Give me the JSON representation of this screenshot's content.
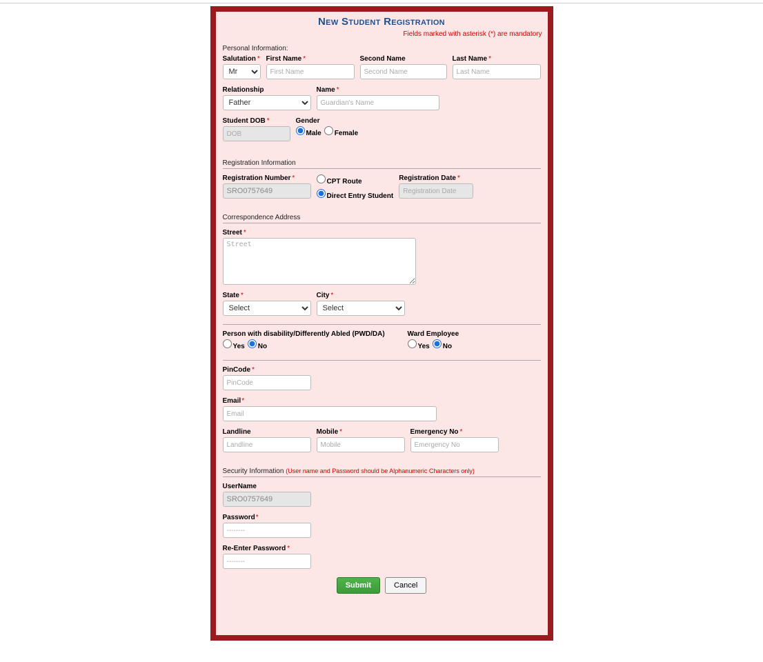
{
  "header": {
    "title": "New Student Registration",
    "mandatory_note": "Fields marked with asterisk (*) are mandatory"
  },
  "sections": {
    "personal": "Personal Information:",
    "registration": "Registration Information",
    "correspondence": "Correspondence Address",
    "security": "Security Information",
    "security_hint": "(User name and Password should be Alphanumeric Characters only)"
  },
  "labels": {
    "salutation": "Salutation",
    "first_name": "First Name",
    "second_name": "Second Name",
    "last_name": "Last Name",
    "relationship": "Relationship",
    "guardian_name": "Name",
    "student_dob": "Student DOB",
    "gender": "Gender",
    "male": "Male",
    "female": "Female",
    "reg_number": "Registration Number",
    "cpt_route": "CPT Route",
    "direct_entry": "Direct Entry Student",
    "reg_date": "Registration Date",
    "street": "Street",
    "state": "State",
    "city": "City",
    "pwd": "Person with disability/Differently Abled (PWD/DA)",
    "ward": "Ward Employee",
    "yes": "Yes",
    "no": "No",
    "pincode": "PinCode",
    "email": "Email",
    "landline": "Landline",
    "mobile": "Mobile",
    "emergency": "Emergency No",
    "username": "UserName",
    "password": "Password",
    "reenter_password": "Re-Enter Password"
  },
  "placeholders": {
    "first_name": "First Name",
    "second_name": "Second Name",
    "last_name": "Last Name",
    "guardian_name": "Guardian's Name",
    "dob": "DOB",
    "reg_date": "Registration Date",
    "street": "Street",
    "pincode": "PinCode",
    "email": "Email",
    "landline": "Landline",
    "mobile": "Mobile",
    "emergency": "Emergency No",
    "password": "--------",
    "reenter_password": "--------"
  },
  "values": {
    "salutation": "Mr",
    "relationship": "Father",
    "reg_number": "SRO0757649",
    "state": "Select",
    "city": "Select",
    "username": "SRO0757649"
  },
  "buttons": {
    "submit": "Submit",
    "cancel": "Cancel"
  }
}
